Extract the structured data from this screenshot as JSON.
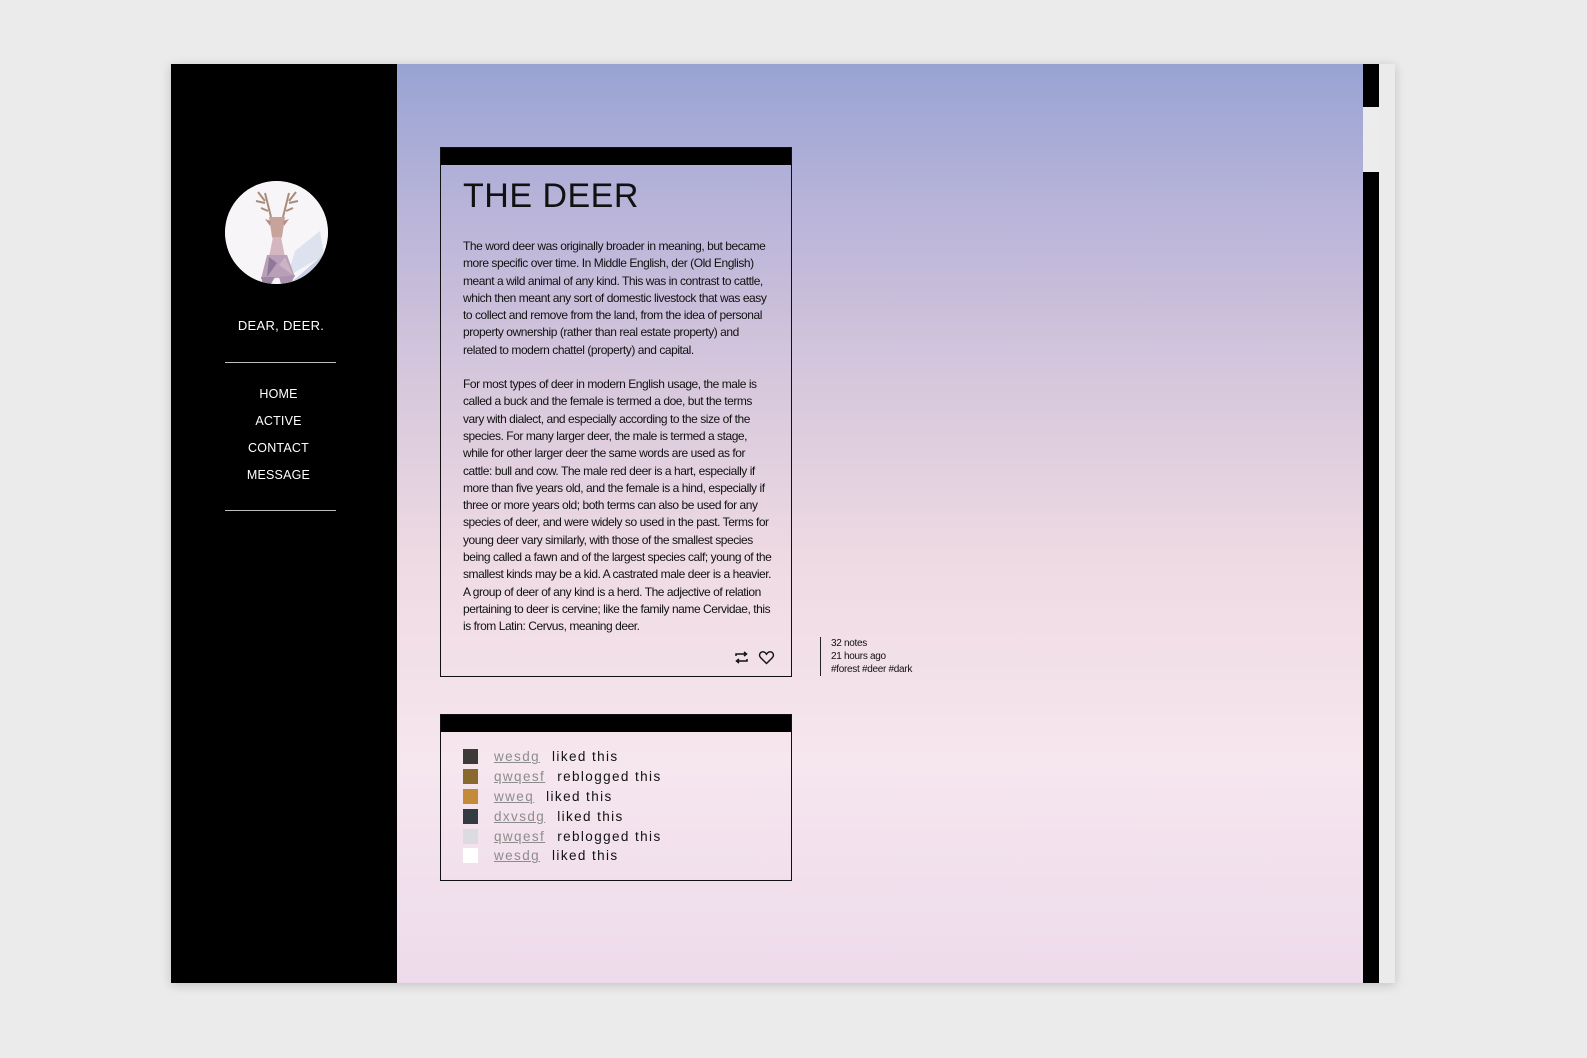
{
  "sidebar": {
    "avatar_icon": "deer-portrait-icon",
    "blog_title": "DEAR, DEER.",
    "nav": [
      "HOME",
      "ACTIVE",
      "CONTACT",
      "MESSAGE"
    ]
  },
  "post": {
    "title": "THE DEER",
    "paragraphs": [
      "The word deer was originally broader in meaning, but became more specific over time. In Middle English, der (Old English) meant a wild animal of any kind. This was in contrast to cattle, which then meant any sort of domestic livestock that was easy to collect and remove from the land, from the idea of personal property ownership (rather than real estate property) and related to modern chattel (property) and capital.",
      "For most types of deer in modern English usage, the male is called a buck and the female is termed a doe, but the terms vary with dialect, and especially according to the size of the species. For many larger deer, the male is termed a stage, while for other larger deer the same words are used as for cattle: bull and cow. The male red deer is a hart, especially if more than five years old, and the female is a hind, especially if three or more years old; both terms can also be used for any species of deer, and were widely so used in the past. Terms for young deer vary similarly, with those of the smallest species being called a fawn and of the largest species calf; young of the smallest kinds may be a kid. A castrated male deer is a heavier. A group of deer of any kind is a herd. The adjective of relation pertaining to deer is cervine; like the family name Cervidae, this is from Latin: Cervus, meaning deer."
    ],
    "actions": {
      "reblog_icon": "reblog-icon",
      "like_icon": "heart-icon"
    }
  },
  "meta": {
    "notes": "32 notes",
    "time": "21 hours ago",
    "tags": "#forest #deer #dark"
  },
  "notes": [
    {
      "user": "wesdg",
      "action": "liked this",
      "avatar_color": "#3e3a38"
    },
    {
      "user": "qwqesf",
      "action": "reblogged this",
      "avatar_color": "#8a6a2c"
    },
    {
      "user": "wweq",
      "action": "liked this",
      "avatar_color": "#c38a3a"
    },
    {
      "user": "dxvsdg",
      "action": "liked this",
      "avatar_color": "#333a42"
    },
    {
      "user": "qwqesf",
      "action": "reblogged this",
      "avatar_color": "#dcdce0"
    },
    {
      "user": "wesdg",
      "action": "liked this",
      "avatar_color": "#ffffff"
    }
  ]
}
